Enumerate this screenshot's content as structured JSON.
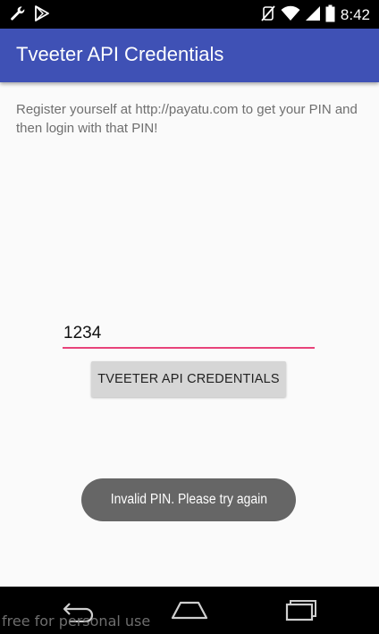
{
  "status_bar": {
    "time": "8:42",
    "left_icons": [
      "wrench-icon",
      "play-store-icon"
    ],
    "right_icons": [
      "mute-icon",
      "wifi-icon",
      "signal-icon",
      "battery-icon"
    ]
  },
  "app_bar": {
    "title": "Tveeter API Credentials",
    "color": "#3f51b5"
  },
  "main": {
    "instructions": "Register yourself at http://payatu.com to get your PIN and then login with that PIN!",
    "pin_input": {
      "value": "1234",
      "underline_color": "#e8437a"
    },
    "button_label": "TVEETER API CREDENTIALS"
  },
  "toast": {
    "message": "Invalid PIN. Please try again"
  },
  "nav_bar": {
    "buttons": [
      "back-icon",
      "home-icon",
      "recents-icon"
    ]
  },
  "watermark": "free for personal use"
}
